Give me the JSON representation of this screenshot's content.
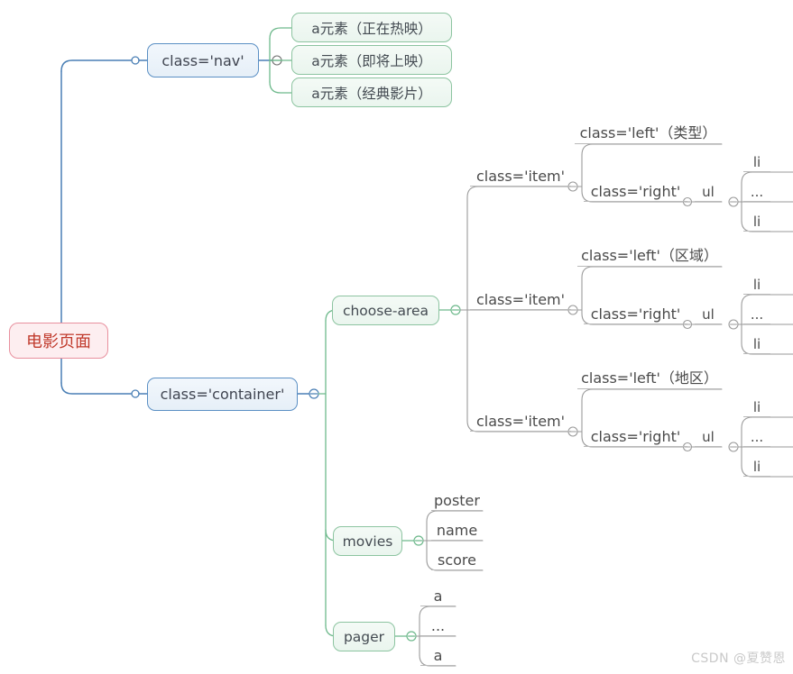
{
  "diagram": {
    "title": "电影页面",
    "watermark": "CSDN @夏赞恩",
    "root": {
      "label": "电影页面"
    },
    "nav": {
      "label": "class='nav'",
      "children": [
        {
          "label": "a元素（正在热映）"
        },
        {
          "label": "a元素（即将上映）"
        },
        {
          "label": "a元素（经典影片）"
        }
      ]
    },
    "container": {
      "label": "class='container'",
      "choose_area": {
        "label": "choose-area",
        "items": [
          {
            "label": "class='item'",
            "left": "class='left'（类型）",
            "right": "class='right'",
            "ul": "ul",
            "li": [
              "li",
              "...",
              "li"
            ]
          },
          {
            "label": "class='item'",
            "left": "class='left'（区域）",
            "right": "class='right'",
            "ul": "ul",
            "li": [
              "li",
              "...",
              "li"
            ]
          },
          {
            "label": "class='item'",
            "left": "class='left'（地区）",
            "right": "class='right'",
            "ul": "ul",
            "li": [
              "li",
              "...",
              "li"
            ]
          }
        ]
      },
      "movies": {
        "label": "movies",
        "children": [
          "poster",
          "name",
          "score"
        ]
      },
      "pager": {
        "label": "pager",
        "children": [
          "a",
          "...",
          "a"
        ]
      }
    },
    "colors": {
      "root_border": "#e8909e",
      "root_fill": "#fdeef0",
      "root_text": "#c0392b",
      "blue_border": "#5a8fc4",
      "green_border": "#8cc4a0",
      "wire_blue": "#4a7fb5",
      "wire_green": "#6eb98c",
      "wire_gray": "#9a9a9a",
      "text_gray": "#4a4a4a",
      "watermark": "#c9c9c9"
    }
  }
}
